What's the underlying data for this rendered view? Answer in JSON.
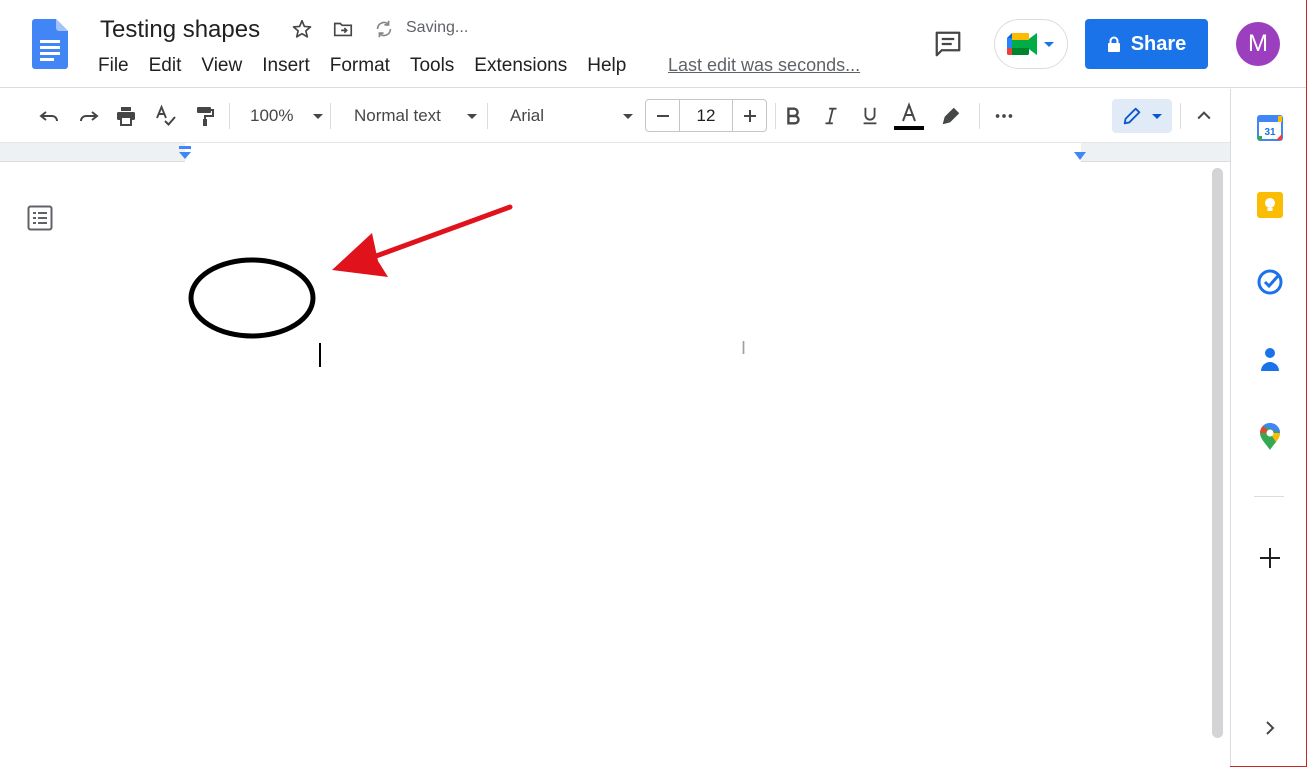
{
  "header": {
    "title": "Testing shapes",
    "status": "Saving...",
    "last_edit": "Last edit was seconds...",
    "share_label": "Share",
    "avatar_initial": "M"
  },
  "menu": {
    "items": [
      {
        "label": "File"
      },
      {
        "label": "Edit"
      },
      {
        "label": "View"
      },
      {
        "label": "Insert"
      },
      {
        "label": "Format"
      },
      {
        "label": "Tools"
      },
      {
        "label": "Extensions"
      },
      {
        "label": "Help"
      }
    ]
  },
  "toolbar": {
    "zoom": "100%",
    "style": "Normal text",
    "font": "Arial",
    "font_size": "12"
  },
  "side_panel": {
    "calendar_day": "31"
  },
  "colors": {
    "accent": "#1a73e8",
    "annotation_arrow": "#e0121b",
    "avatar": "#9c3fbf"
  },
  "icons": [
    "undo-icon",
    "redo-icon",
    "print-icon",
    "spellcheck-icon",
    "paint-format-icon",
    "bold-icon",
    "italic-icon",
    "underline-icon",
    "text-color-icon",
    "highlight-icon",
    "more-icon",
    "edit-mode-icon",
    "collapse-icon",
    "calendar-icon",
    "keep-icon",
    "tasks-icon",
    "contacts-icon",
    "maps-icon",
    "add-icon",
    "expand-panel-icon"
  ]
}
